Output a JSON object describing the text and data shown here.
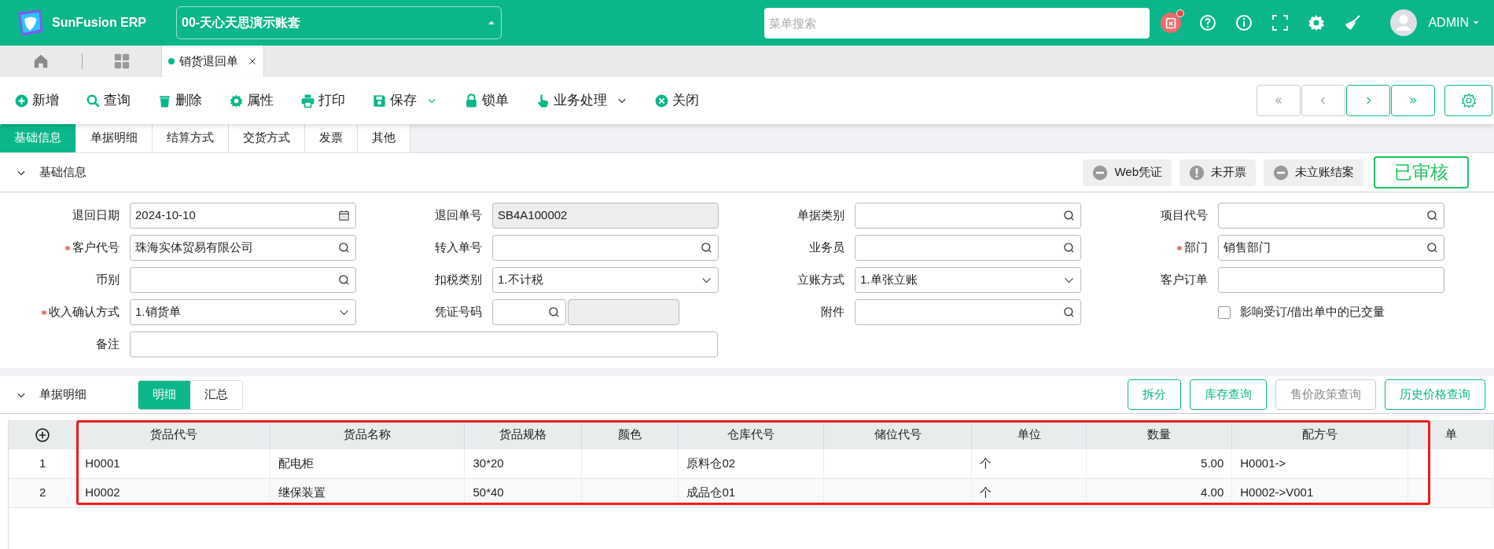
{
  "header": {
    "logo_text": "SunFusion ERP",
    "account": "00-天心天思演示账套",
    "search_placeholder": "菜单搜索",
    "notification": true,
    "user": "ADMIN"
  },
  "open_tabs": [
    {
      "label": "销货退回单",
      "selected": true
    }
  ],
  "toolbar": [
    {
      "label": "新增",
      "kind": "add",
      "dropdown": false
    },
    {
      "label": "查询",
      "kind": "search",
      "dropdown": false
    },
    {
      "label": "删除",
      "kind": "trash",
      "dropdown": false
    },
    {
      "label": "属性",
      "kind": "gear",
      "dropdown": false
    },
    {
      "label": "打印",
      "kind": "print",
      "dropdown": false
    },
    {
      "label": "保存",
      "kind": "save",
      "dropdown": true
    },
    {
      "label": "锁单",
      "kind": "lock",
      "dropdown": false
    },
    {
      "label": "业务处理",
      "kind": "hand",
      "dropdown": true
    },
    {
      "label": "关闭",
      "kind": "close",
      "dropdown": false
    }
  ],
  "nav_buttons": [
    {
      "kind": "first",
      "disabled": true
    },
    {
      "kind": "prev",
      "disabled": true
    },
    {
      "kind": "next",
      "disabled": false
    },
    {
      "kind": "last",
      "disabled": false
    }
  ],
  "form_tabs": [
    {
      "label": "基础信息",
      "selected": true
    },
    {
      "label": "单据明细",
      "selected": false
    },
    {
      "label": "结算方式",
      "selected": false
    },
    {
      "label": "交货方式",
      "selected": false
    },
    {
      "label": "发票",
      "selected": false
    },
    {
      "label": "其他",
      "selected": false
    }
  ],
  "basic_section": {
    "title": "基础信息",
    "expanded": true,
    "badges": [
      {
        "label": "Web凭证",
        "kind": "minus"
      },
      {
        "label": "未开票",
        "kind": "exclaim"
      },
      {
        "label": "未立账结案",
        "kind": "minus"
      }
    ],
    "status": "已审核",
    "fields": [
      {
        "label": "退回日期",
        "required": false,
        "kind": "date",
        "value": "2024-10-10"
      },
      {
        "label": "退回单号",
        "required": false,
        "kind": "readonly",
        "value": "SB4A100002"
      },
      {
        "label": "单据类别",
        "required": false,
        "kind": "lookup"
      },
      {
        "label": "项目代号",
        "required": false,
        "kind": "lookup"
      },
      {
        "label": "客户代号",
        "required": true,
        "kind": "lookup",
        "value": "珠海实体贸易有限公司"
      },
      {
        "label": "转入单号",
        "required": false,
        "kind": "lookup"
      },
      {
        "label": "业务员",
        "required": false,
        "kind": "lookup"
      },
      {
        "label": "部门",
        "required": true,
        "kind": "lookup",
        "value": "销售部门"
      },
      {
        "label": "币别",
        "required": false,
        "kind": "lookup"
      },
      {
        "label": "扣税类别",
        "required": false,
        "kind": "select",
        "value": "1.不计税"
      },
      {
        "label": "立账方式",
        "required": false,
        "kind": "select",
        "value": "1.单张立账"
      },
      {
        "label": "客户订单",
        "required": false,
        "kind": "text"
      },
      {
        "label": "收入确认方式",
        "required": true,
        "kind": "select",
        "value": "1.销货单"
      },
      {
        "label": "凭证号码",
        "required": false,
        "kind": "pair"
      },
      {
        "label": "附件",
        "required": false,
        "kind": "lookup"
      },
      {
        "label": "影响受订/借出单中的已交量",
        "kind": "checkbox",
        "checked": false
      },
      {
        "label": "备注",
        "required": false,
        "kind": "wide"
      }
    ]
  },
  "detail_section": {
    "title": "单据明细",
    "expanded": true,
    "views": [
      {
        "label": "明细",
        "selected": true
      },
      {
        "label": "汇总",
        "selected": false
      }
    ],
    "buttons": [
      {
        "label": "拆分",
        "disabled": false
      },
      {
        "label": "库存查询",
        "disabled": false
      },
      {
        "label": "售价政策查询",
        "disabled": true
      },
      {
        "label": "历史价格查询",
        "disabled": false
      }
    ]
  },
  "table": {
    "columns": [
      {
        "label": "货品代号",
        "kind": "text"
      },
      {
        "label": "货品名称",
        "kind": "text"
      },
      {
        "label": "货品规格",
        "kind": "text"
      },
      {
        "label": "颜色",
        "kind": "text"
      },
      {
        "label": "仓库代号",
        "kind": "text"
      },
      {
        "label": "储位代号",
        "kind": "text"
      },
      {
        "label": "单位",
        "kind": "text"
      },
      {
        "label": "数量",
        "kind": "number"
      },
      {
        "label": "配方号",
        "kind": "text"
      },
      {
        "label": "单",
        "kind": "text"
      }
    ],
    "rows": [
      {
        "number": "1",
        "cells": [
          "H0001",
          "配电柜",
          "30*20",
          "",
          "原料仓02",
          "",
          "个",
          "5.00",
          "H0001->",
          ""
        ]
      },
      {
        "number": "2",
        "cells": [
          "H0002",
          "继保装置",
          "50*40",
          "",
          "成品仓01",
          "",
          "个",
          "4.00",
          "H0002->V001",
          ""
        ]
      }
    ]
  }
}
